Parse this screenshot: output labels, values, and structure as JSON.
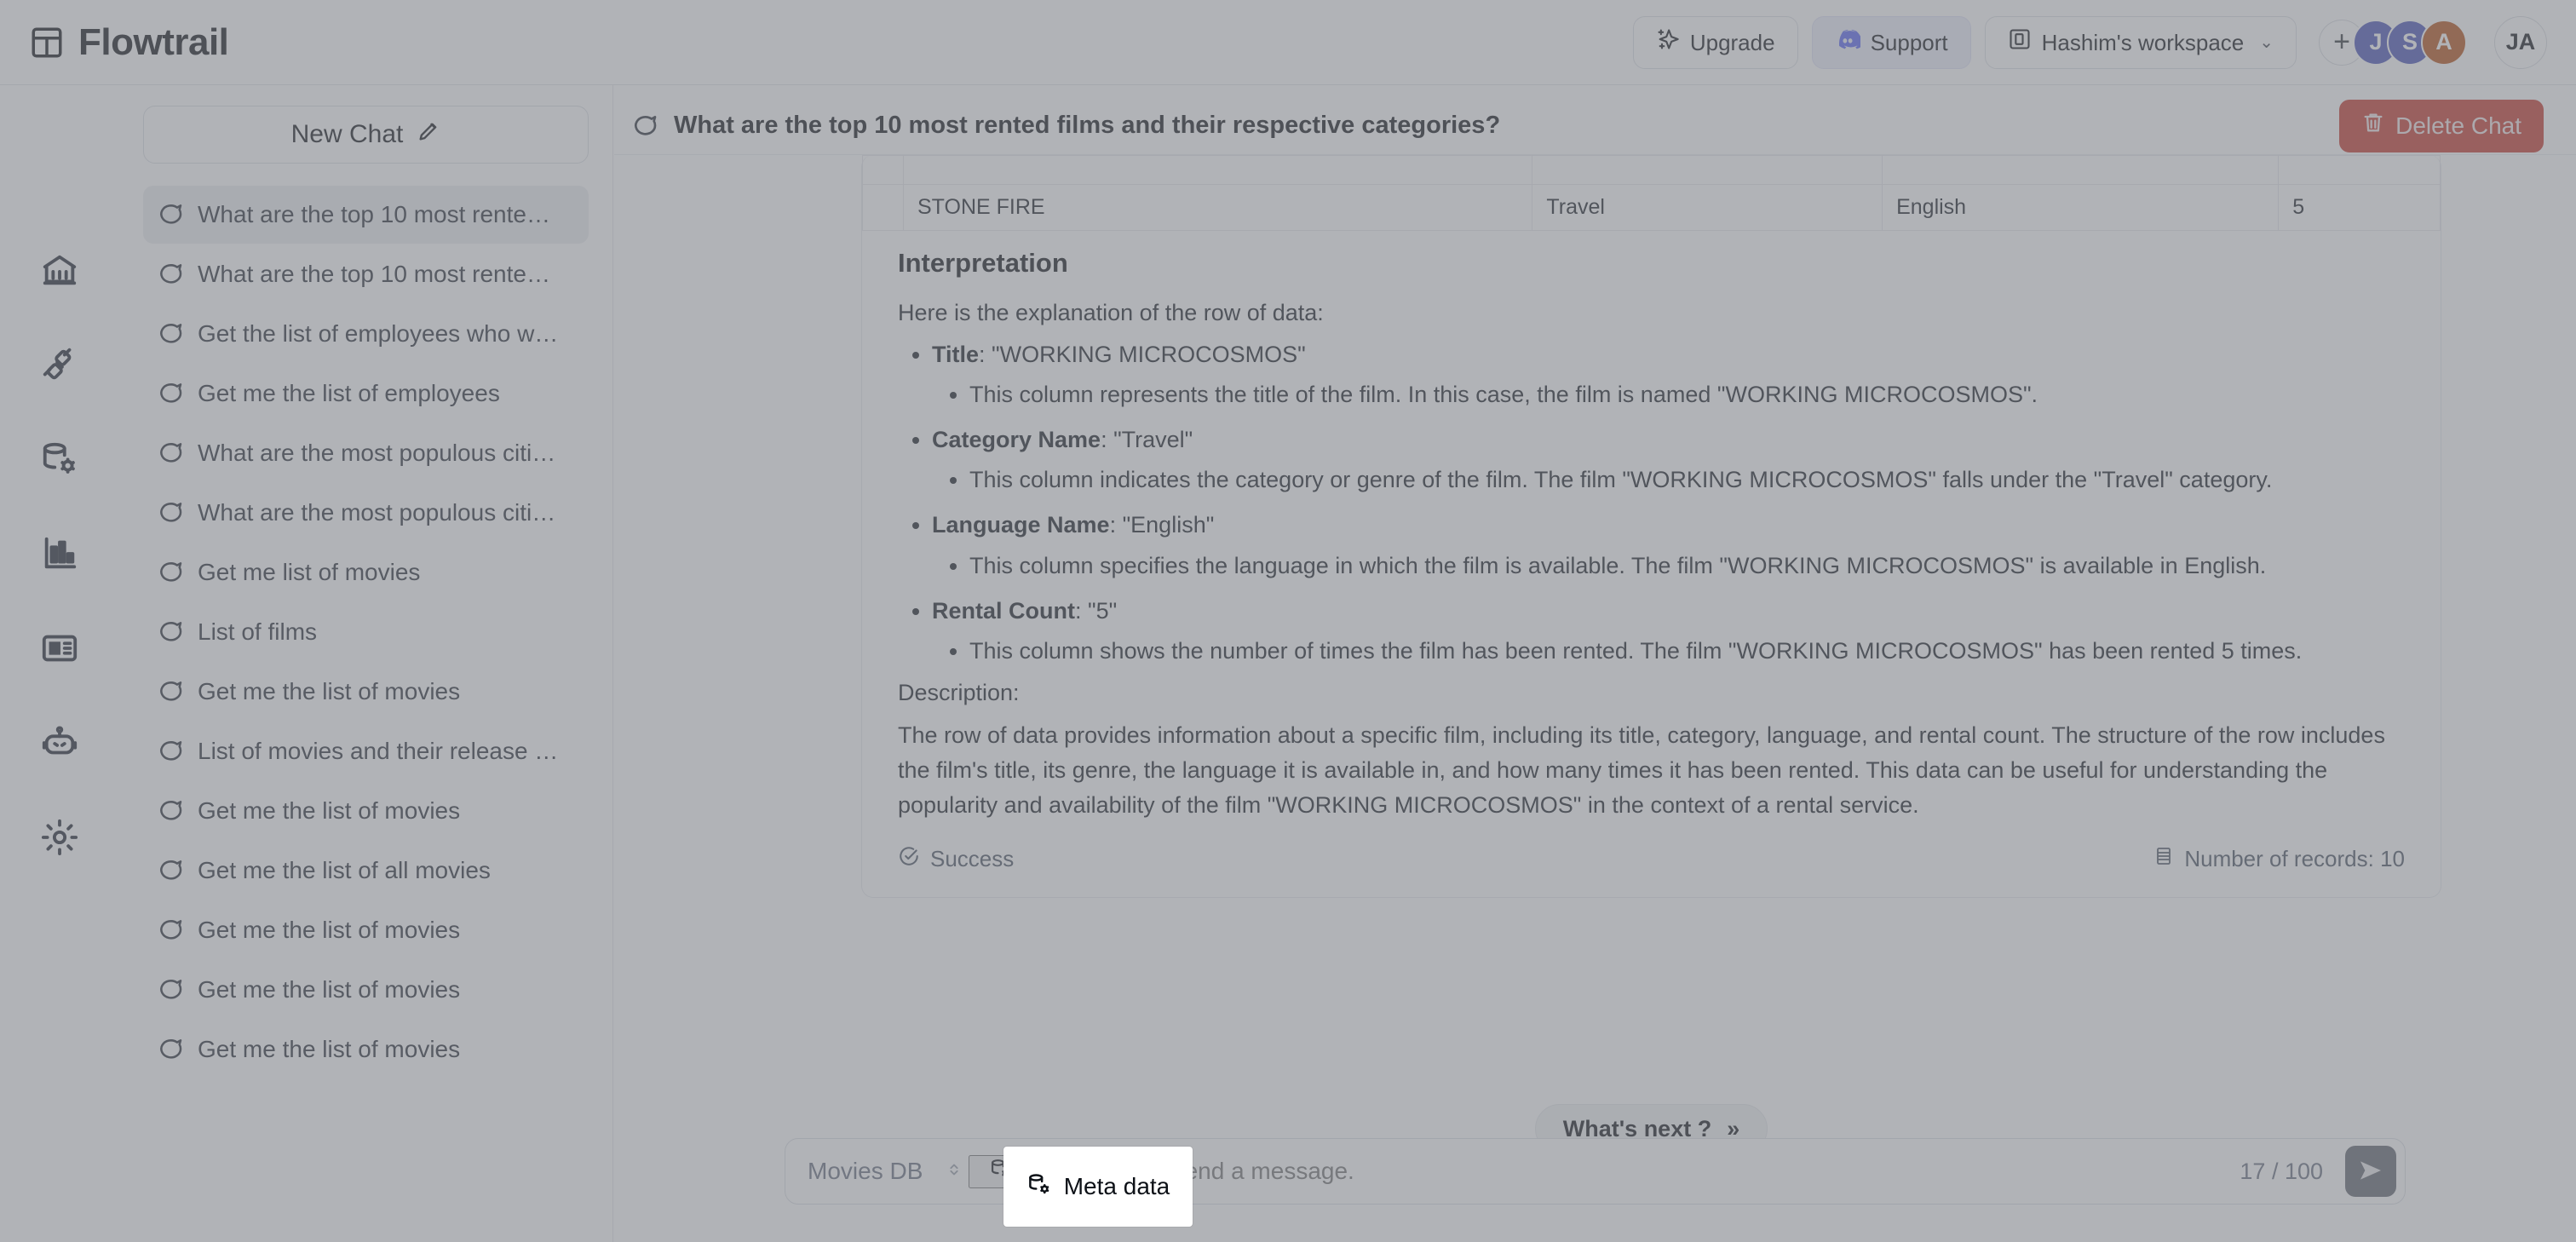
{
  "app": {
    "brand_name": "Flowtrail",
    "brand_icon": "layout-grid-icon"
  },
  "header": {
    "upgrade_label": "Upgrade",
    "support_label": "Support",
    "workspace_label": "Hashim's workspace",
    "workspace_chevron": "⌄",
    "add_member_label": "+",
    "avatars": [
      {
        "initial": "J",
        "color": "#4a53b8"
      },
      {
        "initial": "S",
        "color": "#4a53b8"
      },
      {
        "initial": "A",
        "color": "#b5521a"
      }
    ],
    "user_avatar": "JA"
  },
  "rail": {
    "items": [
      {
        "name": "home-bank-icon",
        "label": "Home"
      },
      {
        "name": "connections-plug-icon",
        "label": "Connections"
      },
      {
        "name": "database-settings-icon",
        "label": "Databases"
      },
      {
        "name": "bar-chart-icon",
        "label": "Charts"
      },
      {
        "name": "dashboard-card-icon",
        "label": "Dashboards"
      },
      {
        "name": "robot-icon",
        "label": "Agents"
      },
      {
        "name": "gear-icon",
        "label": "Settings"
      }
    ]
  },
  "sidebar": {
    "new_chat_label": "New Chat",
    "chats": [
      {
        "label": "What are the top 10 most rente…",
        "active": true
      },
      {
        "label": "What are the top 10 most rente…",
        "active": false
      },
      {
        "label": "Get the list of employees who w…",
        "active": false
      },
      {
        "label": "Get me the list of employees",
        "active": false
      },
      {
        "label": "What are the most populous citi…",
        "active": false
      },
      {
        "label": "What are the most populous citi…",
        "active": false
      },
      {
        "label": "Get me list of movies",
        "active": false
      },
      {
        "label": "List of films",
        "active": false
      },
      {
        "label": "Get me the list of movies",
        "active": false
      },
      {
        "label": "List of movies and their release …",
        "active": false
      },
      {
        "label": "Get me the list of movies",
        "active": false
      },
      {
        "label": "Get me the list of all movies",
        "active": false
      },
      {
        "label": "Get me the list of movies",
        "active": false
      },
      {
        "label": "Get me the list of movies",
        "active": false
      },
      {
        "label": "Get me the list of movies",
        "active": false
      }
    ]
  },
  "main": {
    "chat_title": "What are the top 10 most rented films and their respective categories?",
    "delete_label": "Delete Chat",
    "table_row": {
      "title": "STONE FIRE",
      "category": "Travel",
      "language": "English",
      "rental_count": "5"
    },
    "interpretation": {
      "heading": "Interpretation",
      "intro": "Here is the explanation of the row of data:",
      "items": [
        {
          "term": "Title",
          "value": ": \"WORKING MICROCOSMOS\"",
          "detail": "This column represents the title of the film. In this case, the film is named \"WORKING MICROCOSMOS\"."
        },
        {
          "term": "Category Name",
          "value": ": \"Travel\"",
          "detail": "This column indicates the category or genre of the film. The film \"WORKING MICROCOSMOS\" falls under the \"Travel\" category."
        },
        {
          "term": "Language Name",
          "value": ": \"English\"",
          "detail": "This column specifies the language in which the film is available. The film \"WORKING MICROCOSMOS\" is available in English."
        },
        {
          "term": "Rental Count",
          "value": ": \"5\"",
          "detail": "This column shows the number of times the film has been rented. The film \"WORKING MICROCOSMOS\" has been rented 5 times."
        }
      ],
      "description_label": "Description:",
      "description_body": "The row of data provides information about a specific film, including its title, category, language, and rental count. The structure of the row includes the film's title, its genre, the language it is available in, and how many times it has been rented. This data can be useful for understanding the popularity and availability of the film \"WORKING MICROCOSMOS\" in the context of a rental service."
    },
    "footer": {
      "status_label": "Success",
      "records_label": "Number of records: 10"
    },
    "whats_next_label": "What's next ?",
    "whats_next_icon": "»"
  },
  "composer": {
    "db_value": "Movies DB",
    "metadata_label": "Meta data",
    "message_placeholder": "Send a message.",
    "message_value": "",
    "counter": "17 / 100",
    "send_icon": "send-icon"
  },
  "colors": {
    "danger": "#c5392f",
    "support_bg": "#eceefb",
    "discord_blue": "#5865f2",
    "avatar_blue": "#4a53b8",
    "avatar_orange": "#b5521a",
    "send_bg": "#636770"
  }
}
